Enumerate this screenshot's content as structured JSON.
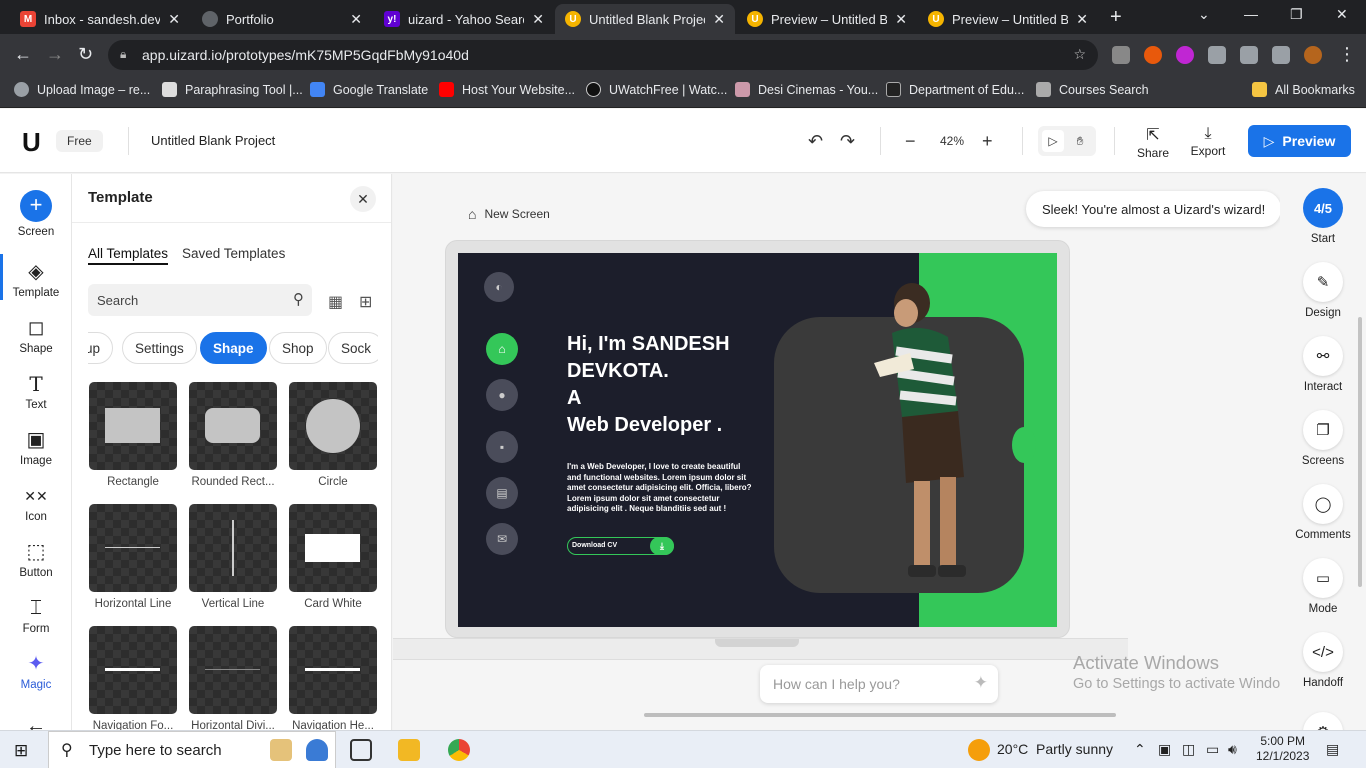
{
  "browser": {
    "tabs": [
      {
        "title": "Inbox - sandesh.devk",
        "color": "#ea4335",
        "glyph": "M"
      },
      {
        "title": "Portfolio",
        "color": "#5f6368",
        "glyph": ""
      },
      {
        "title": "uizard - Yahoo Search",
        "color": "#6001d2",
        "glyph": "y!"
      },
      {
        "title": "Untitled Blank Project",
        "color": "#f5b400",
        "glyph": "U"
      },
      {
        "title": "Preview – Untitled Bl",
        "color": "#f5b400",
        "glyph": "U"
      },
      {
        "title": "Preview – Untitled Bl",
        "color": "#f5b400",
        "glyph": "U"
      }
    ],
    "url": "app.uizard.io/prototypes/mK75MP5GqdFbMy91o40d",
    "bookmarks": [
      {
        "label": "Upload Image – re..."
      },
      {
        "label": "Paraphrasing Tool |..."
      },
      {
        "label": "Google Translate"
      },
      {
        "label": "Host Your Website..."
      },
      {
        "label": "UWatchFree | Watc..."
      },
      {
        "label": "Desi Cinemas - You..."
      },
      {
        "label": "Department of Edu..."
      },
      {
        "label": "Courses Search"
      },
      {
        "label": "All Bookmarks"
      }
    ]
  },
  "header": {
    "plan": "Free",
    "project_name": "Untitled Blank Project",
    "zoom": "42%",
    "share": "Share",
    "export": "Export",
    "preview": "Preview"
  },
  "leftrail": {
    "items": [
      {
        "label": "Screen"
      },
      {
        "label": "Template"
      },
      {
        "label": "Shape"
      },
      {
        "label": "Text"
      },
      {
        "label": "Image"
      },
      {
        "label": "Icon"
      },
      {
        "label": "Button"
      },
      {
        "label": "Form"
      },
      {
        "label": "Magic"
      }
    ]
  },
  "panel": {
    "title": "Template",
    "tabs": [
      "All Templates",
      "Saved Templates"
    ],
    "search_placeholder": "Search",
    "chips": [
      "up",
      "Settings",
      "Shape",
      "Shop",
      "Sock"
    ],
    "cards": [
      "Rectangle",
      "Rounded Rect...",
      "Circle",
      "Horizontal Line",
      "Vertical Line",
      "Card White",
      "Navigation Fo...",
      "Horizontal Divi...",
      "Navigation He..."
    ]
  },
  "canvas": {
    "screen_name": "New Screen",
    "hint": "Sleek! You're almost a Uizard's wizard!",
    "help_placeholder": "How can I help you?",
    "watermark_title": "Activate Windows",
    "watermark_sub": "Go to Settings to activate Windows.",
    "mockup": {
      "title_lines": [
        "Hi, I'm SANDESH",
        "DEVKOTA.",
        "A",
        "Web Developer ."
      ],
      "description": "I'm a Web Developer, I love to create beautiful and functional websites. Lorem ipsum dolor sit amet consectetur adipisicing elit. Officia, libero? Lorem ipsum dolor sit amet consectetur adipisicing elit . Neque blanditiis sed aut !",
      "download_label": "Download CV"
    }
  },
  "rightrail": {
    "progress": "4/5",
    "items": [
      "Start",
      "Design",
      "Interact",
      "Screens",
      "Comments",
      "Mode",
      "Handoff"
    ]
  },
  "taskbar": {
    "search_placeholder": "Type here to search",
    "weather_temp": "20°C",
    "weather_desc": "Partly sunny",
    "time": "5:00 PM",
    "date": "12/1/2023"
  }
}
